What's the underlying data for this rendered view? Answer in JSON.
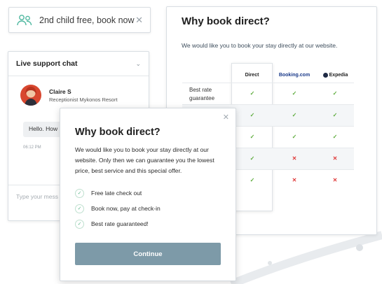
{
  "promo": {
    "text": "2nd child free, book now",
    "close_glyph": "✕",
    "icon": "people-icon",
    "icon_color": "#4fb8a0"
  },
  "compare": {
    "title": "Why book direct?",
    "subtitle": "We would like you to book your stay directly at our website.",
    "columns": [
      "Direct",
      "Booking.com",
      "Expedia"
    ],
    "rows": [
      {
        "label": "Best rate guarantee",
        "values": [
          "✓",
          "✓",
          "✓"
        ]
      },
      {
        "label": "",
        "values": [
          "✓",
          "✓",
          "✓"
        ]
      },
      {
        "label": "",
        "values": [
          "✓",
          "✓",
          "✓"
        ]
      },
      {
        "label": "",
        "values": [
          "✓",
          "✕",
          "✕"
        ]
      },
      {
        "label": "",
        "values": [
          "✓",
          "✕",
          "✕"
        ]
      }
    ],
    "check_color": "#5cab3b",
    "cross_color": "#e03b3b"
  },
  "chat": {
    "title": "Live support chat",
    "chevron_glyph": "⌄",
    "agent_name": "Claire S",
    "agent_role": "Receptionist Mykonos Resort",
    "message": "Hello. How",
    "time": "06:12 PM",
    "input_placeholder": "Type your mess"
  },
  "modal": {
    "close_glyph": "✕",
    "title": "Why book direct?",
    "description": "We would like you to book your stay directly at our website. Only then we can guarantee you the lowest price, best service and this special offer.",
    "features": [
      "Free late check out",
      "Book now, pay at check-in",
      "Best rate guaranteed!"
    ],
    "check_glyph": "✓",
    "cta_label": "Continue",
    "cta_color": "#7d9aa8"
  }
}
